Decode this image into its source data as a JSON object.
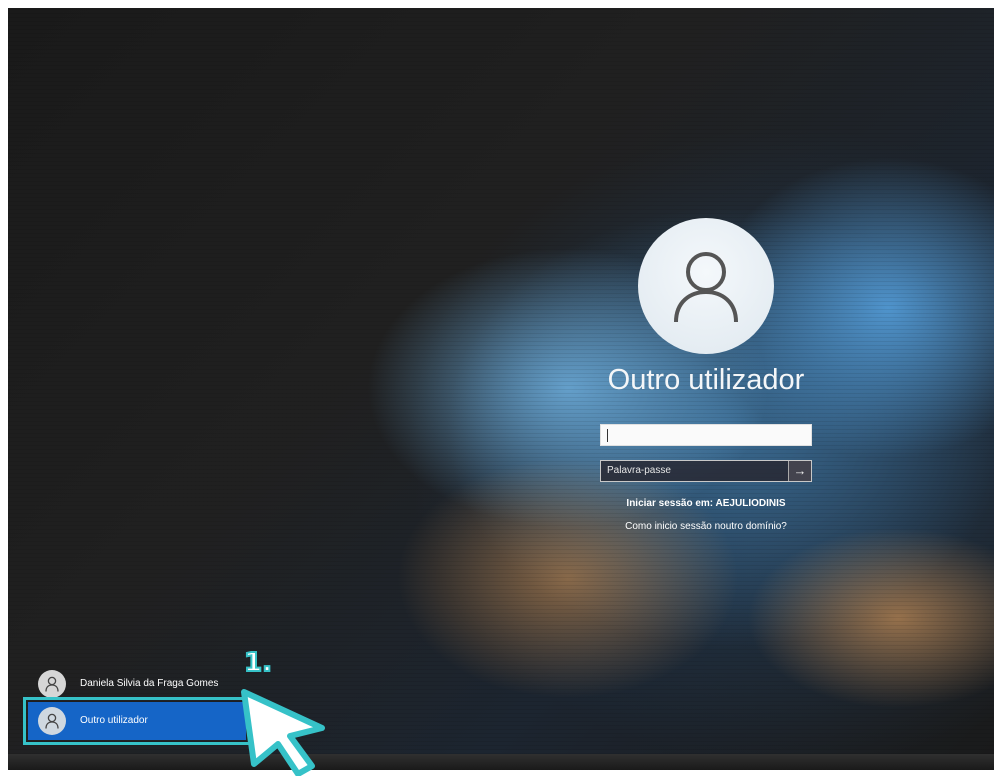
{
  "login": {
    "title": "Outro utilizador",
    "username_value": "",
    "password_placeholder": "Palavra-passe",
    "submit_arrow": "→",
    "signin_to": "Iniciar sessão em: AEJULIODINIS",
    "other_domain_link": "Como inicio sessão noutro domínio?"
  },
  "users": [
    {
      "name": "Daniela Silvia da Fraga Gomes",
      "selected": false
    },
    {
      "name": "Outro utilizador",
      "selected": true
    }
  ],
  "annotation": {
    "step": "1.",
    "accent": "#36c2c8"
  },
  "colors": {
    "selected_user_bg": "#1565c7",
    "text": "#ffffff"
  }
}
